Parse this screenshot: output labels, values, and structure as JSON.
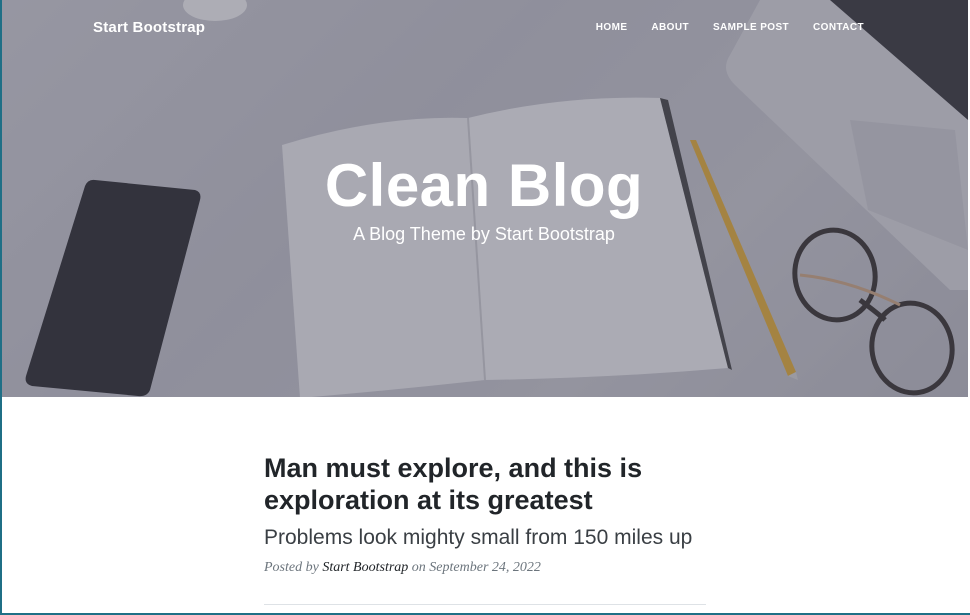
{
  "navbar": {
    "brand": "Start Bootstrap",
    "links": [
      "HOME",
      "ABOUT",
      "SAMPLE POST",
      "CONTACT"
    ]
  },
  "hero": {
    "title": "Clean Blog",
    "subtitle": "A Blog Theme by Start Bootstrap"
  },
  "post": {
    "title": "Man must explore, and this is exploration at its greatest",
    "subtitle": "Problems look mighty small from 150 miles up",
    "meta_prefix": "Posted by",
    "author": "Start Bootstrap",
    "meta_on": "on",
    "date": "September 24, 2022"
  },
  "colors": {
    "accent_frame": "#1f6f86",
    "text_dark": "#212529",
    "text_muted": "#6c757d"
  }
}
